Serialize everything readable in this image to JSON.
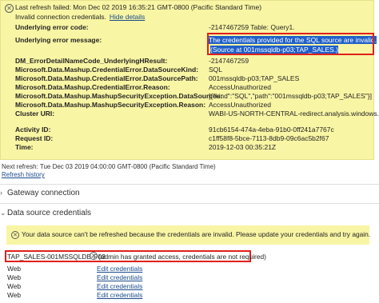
{
  "error_panel": {
    "title": "Last refresh failed: Mon Dec 02 2019 16:35:21 GMT-0800 (Pacific Standard Time)",
    "subtitle": "Invalid connection credentials.",
    "hide_details_label": "Hide details",
    "icon": "error-x-icon",
    "rows": [
      {
        "key": "Underlying error code:",
        "value": "-2147467259 Table: Query1."
      },
      {
        "key": "Underlying error message:",
        "value": "The credentials provided for the SQL source are invalid."
      },
      {
        "key": "",
        "value": "(Source at 001mssqldb-p03;TAP_SALES.)"
      },
      {
        "key": "DM_ErrorDetailNameCode_UnderlyingHResult:",
        "value": "-2147467259"
      },
      {
        "key": "Microsoft.Data.Mashup.CredentialError.DataSourceKind:",
        "value": "SQL"
      },
      {
        "key": "Microsoft.Data.Mashup.CredentialError.DataSourcePath:",
        "value": "001mssqldb-p03;TAP_SALES"
      },
      {
        "key": "Microsoft.Data.Mashup.CredentialError.Reason:",
        "value": "AccessUnauthorized"
      },
      {
        "key": "Microsoft.Data.Mashup.MashupSecurityException.DataSources:",
        "value": "[{\"kind\":\"SQL\",\"path\":\"001mssqldb-p03;TAP_SALES\"}]"
      },
      {
        "key": "Microsoft.Data.Mashup.MashupSecurityException.Reason:",
        "value": "AccessUnauthorized"
      },
      {
        "key": "Cluster URI:",
        "value": "WABI-US-NORTH-CENTRAL-redirect.analysis.windows.n"
      },
      {
        "key": "Activity ID:",
        "value": "91cb6154-474a-4eba-91b0-0ff241a7767c"
      },
      {
        "key": "Request ID:",
        "value": "c1ff58f8-5bce-7113-8db9-09c6ac5b2f67"
      },
      {
        "key": "Time:",
        "value": "2019-12-03 00:35:21Z"
      }
    ]
  },
  "next_refresh": "Next refresh: Tue Dec 03 2019 04:00:00 GMT-0800 (Pacific Standard Time)",
  "refresh_history_label": "Refresh history",
  "sections": {
    "gateway": "Gateway connection",
    "data_source": "Data source credentials"
  },
  "warning": {
    "icon": "error-x-icon",
    "text": "Your data source can't be refreshed because the credentials are invalid. Please update your credentials and try again."
  },
  "data_sources": {
    "primary": {
      "name": "TAP_SALES-001MSSQLDB-P03",
      "note": "(admin has granted access, credentials are not required)"
    },
    "rows": [
      {
        "type": "Web",
        "action": "Edit credentials"
      },
      {
        "type": "Web",
        "action": "Edit credentials"
      },
      {
        "type": "Web",
        "action": "Edit credentials"
      },
      {
        "type": "Web",
        "action": "Edit credentials"
      }
    ]
  },
  "colors": {
    "panel_bg": "#f8f5a4",
    "highlight_border": "#e0201b",
    "selection": "#1f5fc8",
    "link": "#1a4b8c"
  }
}
